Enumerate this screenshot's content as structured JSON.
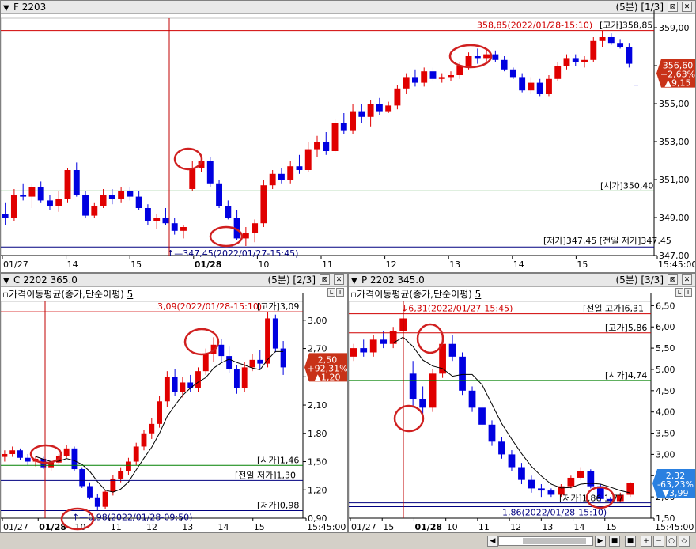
{
  "colors": {
    "up": "#e00000",
    "down": "#0000e0",
    "hline_red": "#d00000",
    "hline_green": "#008000",
    "hline_blue": "#000080",
    "vline": "#c00000",
    "circle": "#d02020",
    "ma": "#000000"
  },
  "window_controls": {
    "settings_icon": "⊠",
    "close_icon": "✕"
  },
  "top_panel": {
    "checkbox": "▼",
    "title": "F 2203",
    "info": "(5분) [1/3]",
    "y_ticks": [
      "359,00",
      "357,00",
      "355,00",
      "353,00",
      "351,00",
      "349,00",
      "347,00"
    ],
    "x_ticks": [
      "01/27",
      "14",
      "15",
      "01/28",
      "10",
      "11",
      "12",
      "13",
      "14",
      "15",
      "15:45:00"
    ],
    "labels": {
      "high_ref": "358,85(2022/01/28-15:10)",
      "high": "[고가]358,85",
      "open": "[시가]350,40",
      "low_overlap": "[저가]347,45 [전일 저가]347,45",
      "low_ref": "347,45(2022/01/27-15:45)"
    },
    "price_box": {
      "price": "356,60",
      "pct": "+2,63%",
      "change": "▲9,15"
    },
    "chart_data": {
      "type": "candlestick",
      "ylim": [
        347,
        359.5
      ],
      "ohlc": [
        [
          349.2,
          349.8,
          348.6,
          349.0
        ],
        [
          349.0,
          350.5,
          348.8,
          350.2
        ],
        [
          350.2,
          350.8,
          349.9,
          350.1
        ],
        [
          350.1,
          350.8,
          349.5,
          350.6
        ],
        [
          350.6,
          350.9,
          349.8,
          349.9
        ],
        [
          349.9,
          350.2,
          349.4,
          349.6
        ],
        [
          349.6,
          350.4,
          349.3,
          350.0
        ],
        [
          350.0,
          351.6,
          349.8,
          351.5
        ],
        [
          351.5,
          351.9,
          350.1,
          350.2
        ],
        [
          350.2,
          350.4,
          349.0,
          349.1
        ],
        [
          349.1,
          349.8,
          349.0,
          349.6
        ],
        [
          349.6,
          350.5,
          349.5,
          350.2
        ],
        [
          350.2,
          350.5,
          349.7,
          350.0
        ],
        [
          350.0,
          350.6,
          349.8,
          350.4
        ],
        [
          350.4,
          350.6,
          349.9,
          350.1
        ],
        [
          350.1,
          350.4,
          349.4,
          349.5
        ],
        [
          349.5,
          349.7,
          348.6,
          348.8
        ],
        [
          348.8,
          349.2,
          348.4,
          349.0
        ],
        [
          349.0,
          349.5,
          348.6,
          348.7
        ],
        [
          348.7,
          349.0,
          348.1,
          348.3
        ],
        [
          348.3,
          348.6,
          347.9,
          348.5
        ],
        [
          350.5,
          352.0,
          350.4,
          351.6
        ],
        [
          351.6,
          352.3,
          351.4,
          352.0
        ],
        [
          352.0,
          352.2,
          350.6,
          350.8
        ],
        [
          350.8,
          351.0,
          349.5,
          349.6
        ],
        [
          349.6,
          349.9,
          348.9,
          349.0
        ],
        [
          349.0,
          349.4,
          347.8,
          347.9
        ],
        [
          347.9,
          348.5,
          347.5,
          348.2
        ],
        [
          348.2,
          348.9,
          347.7,
          348.7
        ],
        [
          348.7,
          351.0,
          348.5,
          350.7
        ],
        [
          350.7,
          351.5,
          350.5,
          351.3
        ],
        [
          351.3,
          351.6,
          350.8,
          351.0
        ],
        [
          351.0,
          352.0,
          350.8,
          351.7
        ],
        [
          351.7,
          352.3,
          351.3,
          351.5
        ],
        [
          351.5,
          353.0,
          351.4,
          352.6
        ],
        [
          352.6,
          353.3,
          352.2,
          353.0
        ],
        [
          353.0,
          353.5,
          352.3,
          352.5
        ],
        [
          352.5,
          354.2,
          352.4,
          354.0
        ],
        [
          354.0,
          354.5,
          353.4,
          353.6
        ],
        [
          353.6,
          355.0,
          353.4,
          354.6
        ],
        [
          354.6,
          355.0,
          354.0,
          354.3
        ],
        [
          354.3,
          355.2,
          353.8,
          355.0
        ],
        [
          355.0,
          355.3,
          354.4,
          354.6
        ],
        [
          354.6,
          355.1,
          354.5,
          354.9
        ],
        [
          354.9,
          356.0,
          354.7,
          355.8
        ],
        [
          355.8,
          356.6,
          355.5,
          356.4
        ],
        [
          356.4,
          356.8,
          355.9,
          356.1
        ],
        [
          356.1,
          356.9,
          355.9,
          356.7
        ],
        [
          356.7,
          356.9,
          356.2,
          356.3
        ],
        [
          356.3,
          356.6,
          356.1,
          356.4
        ],
        [
          356.4,
          356.7,
          356.2,
          356.5
        ],
        [
          356.5,
          357.2,
          356.3,
          357.0
        ],
        [
          357.0,
          357.7,
          356.8,
          357.5
        ],
        [
          357.5,
          357.9,
          357.1,
          357.4
        ],
        [
          357.4,
          357.8,
          357.2,
          357.6
        ],
        [
          357.6,
          357.8,
          357.2,
          357.3
        ],
        [
          357.3,
          357.5,
          356.7,
          356.8
        ],
        [
          356.8,
          356.9,
          356.3,
          356.4
        ],
        [
          356.4,
          356.6,
          355.6,
          355.7
        ],
        [
          355.7,
          356.4,
          355.5,
          356.1
        ],
        [
          356.1,
          356.3,
          355.4,
          355.5
        ],
        [
          355.5,
          356.5,
          355.4,
          356.3
        ],
        [
          356.3,
          357.2,
          356.2,
          357.0
        ],
        [
          357.0,
          357.6,
          356.8,
          357.4
        ],
        [
          357.4,
          357.6,
          357.0,
          357.2
        ],
        [
          357.2,
          357.5,
          356.9,
          357.3
        ],
        [
          357.3,
          358.5,
          357.2,
          358.3
        ],
        [
          358.3,
          358.85,
          358.0,
          358.5
        ],
        [
          358.5,
          358.7,
          358.1,
          358.2
        ],
        [
          358.2,
          358.4,
          357.9,
          358.0
        ],
        [
          358.0,
          358.2,
          356.9,
          357.1
        ]
      ]
    }
  },
  "bottom_left": {
    "checkbox": "▼",
    "title": "C 2202 365.0",
    "info": "(5분) [2/3]",
    "subtitle": "가격이동평균(종가,단순이평)",
    "subtitle_param": "5",
    "y_ticks": [
      "3,00",
      "2,70",
      "2,40",
      "2,10",
      "1,80",
      "1,50",
      "1,20",
      "0,90"
    ],
    "x_ticks": [
      "01/27",
      "01/28",
      "10",
      "11",
      "12",
      "13",
      "14",
      "15",
      "15:45:00"
    ],
    "labels": {
      "high_ref": "3,09(2022/01/28-15:10)",
      "high": "[고가]3,09",
      "open": "[시가]1,46",
      "prev_low": "[전일 저가]1,30",
      "low": "[저가]0,98",
      "low_ref": "0,98(2022/01/28-09:50)"
    },
    "price_box": {
      "price": "2,50",
      "pct": "+92,31%",
      "change": "▲1,20"
    },
    "chart_data": {
      "type": "candlestick",
      "ylim": [
        0.9,
        3.2
      ],
      "ohlc": [
        [
          1.55,
          1.62,
          1.5,
          1.58
        ],
        [
          1.58,
          1.66,
          1.55,
          1.62
        ],
        [
          1.62,
          1.64,
          1.52,
          1.54
        ],
        [
          1.54,
          1.58,
          1.46,
          1.5
        ],
        [
          1.5,
          1.56,
          1.45,
          1.53
        ],
        [
          1.53,
          1.55,
          1.42,
          1.44
        ],
        [
          1.44,
          1.52,
          1.4,
          1.49
        ],
        [
          1.49,
          1.58,
          1.47,
          1.56
        ],
        [
          1.56,
          1.68,
          1.54,
          1.64
        ],
        [
          1.64,
          1.66,
          1.4,
          1.42
        ],
        [
          1.42,
          1.44,
          1.22,
          1.24
        ],
        [
          1.24,
          1.28,
          1.1,
          1.12
        ],
        [
          1.12,
          1.16,
          0.98,
          1.02
        ],
        [
          1.02,
          1.2,
          1.0,
          1.18
        ],
        [
          1.18,
          1.36,
          1.14,
          1.32
        ],
        [
          1.32,
          1.44,
          1.28,
          1.4
        ],
        [
          1.4,
          1.54,
          1.36,
          1.5
        ],
        [
          1.5,
          1.7,
          1.46,
          1.66
        ],
        [
          1.66,
          1.84,
          1.62,
          1.8
        ],
        [
          1.8,
          1.96,
          1.74,
          1.9
        ],
        [
          1.9,
          2.2,
          1.86,
          2.14
        ],
        [
          2.14,
          2.46,
          2.08,
          2.4
        ],
        [
          2.4,
          2.48,
          2.2,
          2.24
        ],
        [
          2.24,
          2.4,
          2.18,
          2.34
        ],
        [
          2.34,
          2.42,
          2.24,
          2.28
        ],
        [
          2.28,
          2.5,
          2.24,
          2.46
        ],
        [
          2.46,
          2.7,
          2.42,
          2.64
        ],
        [
          2.64,
          2.82,
          2.56,
          2.74
        ],
        [
          2.74,
          2.8,
          2.56,
          2.62
        ],
        [
          2.62,
          2.72,
          2.44,
          2.48
        ],
        [
          2.48,
          2.52,
          2.22,
          2.28
        ],
        [
          2.28,
          2.56,
          2.24,
          2.5
        ],
        [
          2.5,
          2.64,
          2.46,
          2.58
        ],
        [
          2.58,
          2.68,
          2.48,
          2.54
        ],
        [
          2.54,
          3.09,
          2.5,
          3.02
        ],
        [
          3.02,
          3.06,
          2.66,
          2.7
        ],
        [
          2.7,
          2.78,
          2.42,
          2.5
        ]
      ],
      "ma_period": 5
    }
  },
  "bottom_right": {
    "checkbox": "▼",
    "title": "P 2202 345.0",
    "info": "(5분) [3/3]",
    "subtitle": "가격이동평균(종가,단순이평)",
    "subtitle_param": "5",
    "y_ticks": [
      "6,50",
      "6,00",
      "5,50",
      "5,00",
      "4,50",
      "4,00",
      "3,50",
      "3,00",
      "2,50",
      "2,00",
      "1,50"
    ],
    "x_ticks": [
      "01/27",
      "15",
      "01/28",
      "10",
      "11",
      "12",
      "13",
      "14",
      "15",
      "15:45:00"
    ],
    "labels": {
      "high_ref": "6,31(2022/01/27-15:45)",
      "prev_high": "[전일 고가]6,31",
      "high": "[고가]5,86",
      "open": "[시가]4,74",
      "low_overlap": "[저가]1,86 1,77",
      "low_ref": "1,86(2022/01/28-15:10)"
    },
    "price_box": {
      "price": "2,32",
      "pct": "-63,23%",
      "change": "▼3,99"
    },
    "chart_data": {
      "type": "candlestick",
      "ylim": [
        1.5,
        6.6
      ],
      "ohlc": [
        [
          5.3,
          5.6,
          5.2,
          5.5
        ],
        [
          5.5,
          5.7,
          5.3,
          5.4
        ],
        [
          5.4,
          5.8,
          5.3,
          5.7
        ],
        [
          5.7,
          5.9,
          5.5,
          5.6
        ],
        [
          5.6,
          6.0,
          5.5,
          5.9
        ],
        [
          5.9,
          6.31,
          5.8,
          6.2
        ],
        [
          4.9,
          5.2,
          4.1,
          4.3
        ],
        [
          4.3,
          4.6,
          3.95,
          4.1
        ],
        [
          4.1,
          5.0,
          4.0,
          4.9
        ],
        [
          4.9,
          5.8,
          4.8,
          5.6
        ],
        [
          5.6,
          5.8,
          5.2,
          5.3
        ],
        [
          5.3,
          5.4,
          4.4,
          4.5
        ],
        [
          4.5,
          4.6,
          4.0,
          4.1
        ],
        [
          4.1,
          4.2,
          3.6,
          3.7
        ],
        [
          3.7,
          3.8,
          3.2,
          3.3
        ],
        [
          3.3,
          3.4,
          2.9,
          3.0
        ],
        [
          3.0,
          3.1,
          2.6,
          2.7
        ],
        [
          2.7,
          2.8,
          2.3,
          2.4
        ],
        [
          2.4,
          2.5,
          2.1,
          2.2
        ],
        [
          2.2,
          2.3,
          2.0,
          2.15
        ],
        [
          2.15,
          2.2,
          2.0,
          2.05
        ],
        [
          2.05,
          2.3,
          2.0,
          2.25
        ],
        [
          2.25,
          2.5,
          2.2,
          2.45
        ],
        [
          2.45,
          2.7,
          2.4,
          2.6
        ],
        [
          2.6,
          2.65,
          2.2,
          2.25
        ],
        [
          2.25,
          2.3,
          1.9,
          1.95
        ],
        [
          1.95,
          2.0,
          1.86,
          1.9
        ],
        [
          1.9,
          2.1,
          1.86,
          2.05
        ],
        [
          2.05,
          2.35,
          2.0,
          2.32
        ]
      ],
      "ma_period": 5
    }
  }
}
